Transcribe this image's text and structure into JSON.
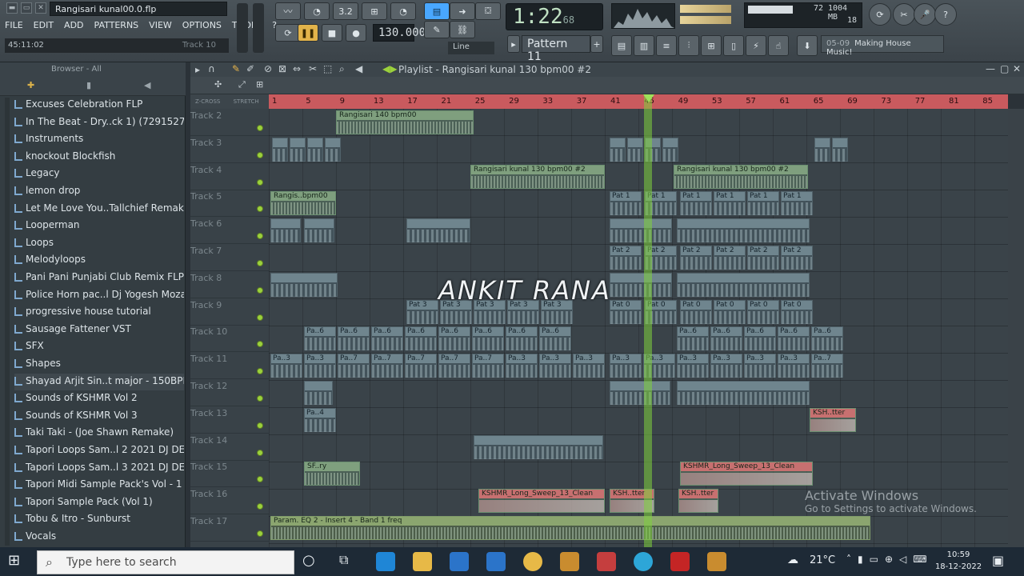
{
  "window": {
    "file_title": "Rangisari kunal00.0.flp"
  },
  "menu": [
    "FILE",
    "EDIT",
    "ADD",
    "PATTERNS",
    "VIEW",
    "OPTIONS",
    "TOOLS",
    "?"
  ],
  "hint": {
    "time": "45:11:02",
    "track": "Track 10"
  },
  "transport": {
    "time_main": "1:22",
    "time_small": "68",
    "time_unit": "M:S:CS",
    "bpm": "130.000",
    "pattern": "Pattern 11",
    "snap": "Line"
  },
  "perf": {
    "cpu": "72",
    "mem": "1004 MB",
    "poly": "18"
  },
  "news": {
    "num": "05-09",
    "text": "Making House Music!"
  },
  "browser": {
    "title": "Browser - All",
    "items": [
      "Excuses Celebration FLP",
      "In The Beat - Dry..ck 1) (72915274)",
      "Instruments",
      "knockout  Blockfish",
      "Legacy",
      "lemon drop",
      "Let Me Love You..Tallchief Remake",
      "Looperman",
      "Loops",
      "Melodyloops",
      "Pani Pani Punjabi Club Remix FLP",
      "Police Horn pac..l Dj Yogesh Mozar",
      "progressive house tutorial",
      "Sausage Fattener VST",
      "SFX",
      "Shapes",
      "Shayad Arjit Sin..t major - 150BPM",
      "Sounds of KSHMR Vol 2",
      "Sounds of KSHMR Vol 3",
      "Taki Taki - (Joe Shawn Remake)",
      "Tapori Loops Sam..l 2 2021 DJ DEVX",
      "Tapori Loops Sam..l 3 2021 DJ DEVX",
      "Tapori Midi Sample Pack's Vol - 1",
      "Tapori Sample Pack (Vol 1)",
      "Tobu & Itro - Sunburst",
      "Vocals"
    ]
  },
  "playlist": {
    "title": "Playlist - Rangisari kunal 130 bpm00 #2",
    "zcross": "Z-CROSS",
    "stretch": "STRETCH",
    "ruler": [
      "1",
      "5",
      "9",
      "13",
      "17",
      "21",
      "25",
      "29",
      "33",
      "37",
      "41",
      "45",
      "49",
      "53",
      "57",
      "61",
      "65",
      "69",
      "73",
      "77",
      "81",
      "85"
    ],
    "tracks": [
      "Track 2",
      "Track 3",
      "Track 4",
      "Track 5",
      "Track 6",
      "Track 7",
      "Track 8",
      "Track 9",
      "Track 10",
      "Track 11",
      "Track 12",
      "Track 13",
      "Track 14",
      "Track 15",
      "Track 16",
      "Track 17"
    ],
    "clips": {
      "rangi140": "Rangisari 140 bpm00",
      "rangi130a": "Rangisari kunal 130 bpm00 #2",
      "rangi130b": "Rangisari kunal 130 bpm00 #2",
      "rangis": "Rangis..bpm00",
      "pat1": "Pat 1",
      "pat2": "Pat 2",
      "pat3": "Pat 3",
      "pat0": "Pat 0",
      "pa6": "Pa..6",
      "pa3": "Pa..3",
      "pa7": "Pa..7",
      "pa4": "Pa..4",
      "sfry": "SF..ry",
      "sweep": "KSHMR_Long_Sweep_13_Clean",
      "ksh": "KSH..tter",
      "param": "Param. EQ 2 - Insert 4 - Band 1 freq"
    }
  },
  "watermark": "ANKIT RANA",
  "activate": {
    "line1": "Activate Windows",
    "line2": "Go to Settings to activate Windows."
  },
  "taskbar": {
    "search": "Type here to search",
    "temp": "21°C",
    "time": "10:59",
    "date": "18-12-2022"
  }
}
